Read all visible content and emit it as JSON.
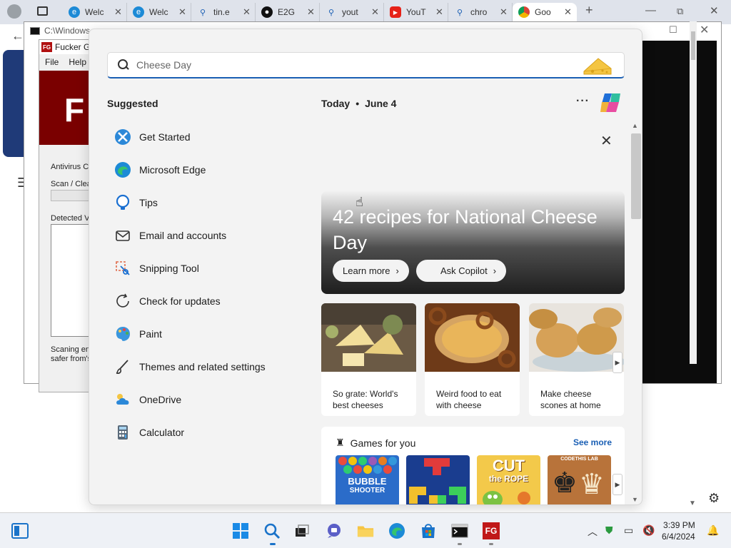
{
  "browser": {
    "tabs": [
      {
        "label": "",
        "icon": "profile-icon"
      },
      {
        "label": "",
        "icon": "tab-actions-icon"
      },
      {
        "label": "Welc",
        "icon": "edge-icon"
      },
      {
        "label": "Welc",
        "icon": "edge-icon"
      },
      {
        "label": "tin.e",
        "icon": "search-icon"
      },
      {
        "label": "E2G",
        "icon": "github-icon"
      },
      {
        "label": "yout",
        "icon": "search-icon"
      },
      {
        "label": "YouT",
        "icon": "youtube-icon"
      },
      {
        "label": "chro",
        "icon": "search-icon"
      },
      {
        "label": "Goo",
        "icon": "chrome-icon"
      }
    ],
    "new_tab": "+"
  },
  "background": {
    "cmd_title": "C:\\Windows",
    "fg_title": "Fucker G",
    "fg_menu": [
      "File",
      "Help"
    ],
    "fg_labels": {
      "antivirus": "Antivirus Co",
      "scan": "Scan / Clea",
      "detected": "Detected V",
      "scanning1": "Scaning en",
      "scanning2": "safer from's"
    }
  },
  "search": {
    "value": "",
    "placeholder": "Cheese Day"
  },
  "suggested": {
    "title": "Suggested",
    "items": [
      {
        "label": "Get Started",
        "icon": "get-started-icon"
      },
      {
        "label": "Microsoft Edge",
        "icon": "edge-icon"
      },
      {
        "label": "Tips",
        "icon": "tips-icon"
      },
      {
        "label": "Email and accounts",
        "icon": "mail-icon"
      },
      {
        "label": "Snipping Tool",
        "icon": "scissors-icon"
      },
      {
        "label": "Check for updates",
        "icon": "refresh-icon"
      },
      {
        "label": "Paint",
        "icon": "paint-icon"
      },
      {
        "label": "Themes and related settings",
        "icon": "brush-icon"
      },
      {
        "label": "OneDrive",
        "icon": "onedrive-icon"
      },
      {
        "label": "Calculator",
        "icon": "calculator-icon"
      }
    ]
  },
  "today": {
    "label": "Today",
    "separator": "•",
    "date": "June 4",
    "more": "···"
  },
  "hero": {
    "title": "42 recipes for National Cheese Day",
    "learn_more": "Learn more",
    "ask_copilot": "Ask Copilot"
  },
  "news": [
    {
      "caption": "So grate: World's best cheeses"
    },
    {
      "caption": "Weird food to eat with cheese"
    },
    {
      "caption": "Make cheese scones at home"
    }
  ],
  "games": {
    "title": "Games for you",
    "see_more": "See more",
    "items": [
      {
        "name": "BUBBLE",
        "sub": "SHOOTER"
      },
      {
        "name": "",
        "sub": ""
      },
      {
        "name": "CUT",
        "sub": "the ROPE"
      },
      {
        "name": "CODETHIS LAB",
        "sub": ""
      }
    ]
  },
  "taskbar": {
    "time": "3:39 PM",
    "date": "6/4/2024"
  },
  "colors": {
    "accent": "#1a5fb4",
    "panel_bg": "#f3f3f3"
  }
}
